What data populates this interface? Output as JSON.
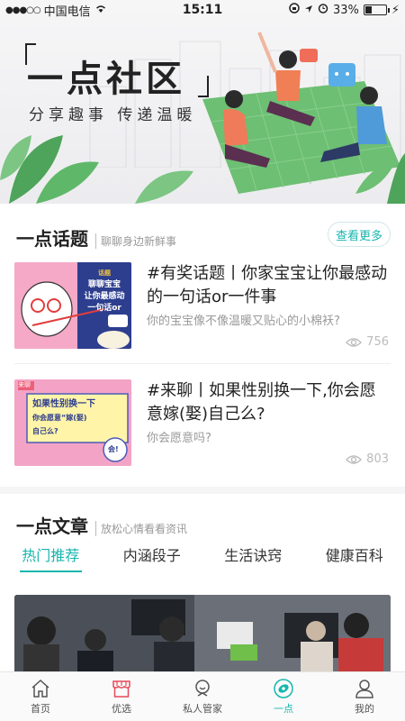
{
  "status_bar": {
    "carrier": "中国电信",
    "time": "15:11",
    "battery": "33%",
    "battery_level": 0.33
  },
  "banner": {
    "title": "一点社区",
    "subtitle": "分享趣事 传递温暖"
  },
  "topics_section": {
    "title": "一点话题",
    "subtitle": "聊聊身边新鲜事",
    "more_label": "查看更多",
    "items": [
      {
        "title": "#有奖话题丨你家宝宝让你最感动的一句话or一件事",
        "desc": "你的宝宝像不像温暖又贴心的小棉袄?",
        "views": "756",
        "thumb_text": [
          "聊聊宝宝",
          "让你最感动",
          "一句话or"
        ],
        "thumb_tag": "话题"
      },
      {
        "title": "#来聊丨如果性别换一下,你会愿意嫁(娶)自己么?",
        "desc": "你会愿意吗?",
        "views": "803",
        "thumb_text": [
          "如果性别换一下",
          "你会愿意“嫁(娶)",
          "自己么?"
        ],
        "thumb_tag": "来聊",
        "thumb_bubble": "会!"
      }
    ]
  },
  "articles_section": {
    "title": "一点文章",
    "subtitle": "放松心情看看资讯",
    "tabs": [
      "热门推荐",
      "内涵段子",
      "生活诀窍",
      "健康百科"
    ],
    "active_tab": 0
  },
  "tab_bar": {
    "items": [
      {
        "label": "首页",
        "icon": "home-icon"
      },
      {
        "label": "优选",
        "icon": "shop-icon"
      },
      {
        "label": "私人管家",
        "icon": "butler-icon"
      },
      {
        "label": "一点",
        "icon": "dot-icon"
      },
      {
        "label": "我的",
        "icon": "person-icon"
      }
    ],
    "active": 3
  },
  "colors": {
    "accent": "#16b6ad"
  }
}
